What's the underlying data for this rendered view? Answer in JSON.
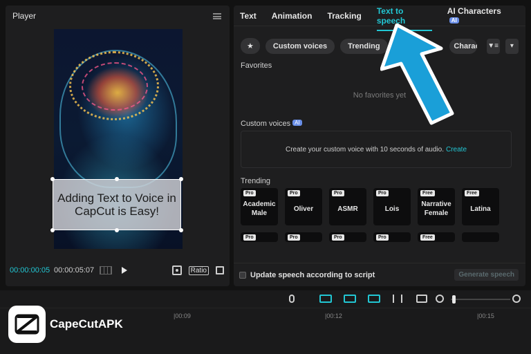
{
  "player": {
    "title": "Player",
    "caption": "Adding Text to Voice in CapCut is Easy!",
    "current_time": "00:00:00:05",
    "total_time": "00:00:05:07",
    "ratio_label": "Ratio"
  },
  "tabs": [
    {
      "label": "Text"
    },
    {
      "label": "Animation"
    },
    {
      "label": "Tracking"
    },
    {
      "label": "Text to speech",
      "active": true
    },
    {
      "label": "AI Characters",
      "badge": "AI"
    }
  ],
  "filters": {
    "custom_voices": "Custom voices",
    "trending": "Trending",
    "characters": "Characte"
  },
  "favorites": {
    "title": "Favorites",
    "empty_text": "No favorites yet"
  },
  "custom_voices": {
    "title": "Custom voices",
    "badge": "AI",
    "prompt": "Create your custom voice with 10 seconds of audio.",
    "link": "Create"
  },
  "trending": {
    "title": "Trending",
    "voices": [
      {
        "tag": "Pro",
        "name": "Academic Male"
      },
      {
        "tag": "Pro",
        "name": "Oliver"
      },
      {
        "tag": "Pro",
        "name": "ASMR"
      },
      {
        "tag": "Pro",
        "name": "Lois"
      },
      {
        "tag": "Free",
        "name": "Narrative Female"
      },
      {
        "tag": "Free",
        "name": "Latina"
      }
    ],
    "second_row_tags": [
      "Pro",
      "Pro",
      "Pro",
      "Pro",
      "Free",
      ""
    ]
  },
  "bottom": {
    "update_label": "Update speech according to script",
    "generate_label": "Generate speech"
  },
  "timeline": {
    "ticks": [
      "|00:09",
      "|00:12",
      "|00:15"
    ]
  },
  "brand": {
    "name": "CapeCutAPK"
  },
  "colors": {
    "accent": "#22c7d4",
    "arrow": "#1a9fd8"
  }
}
